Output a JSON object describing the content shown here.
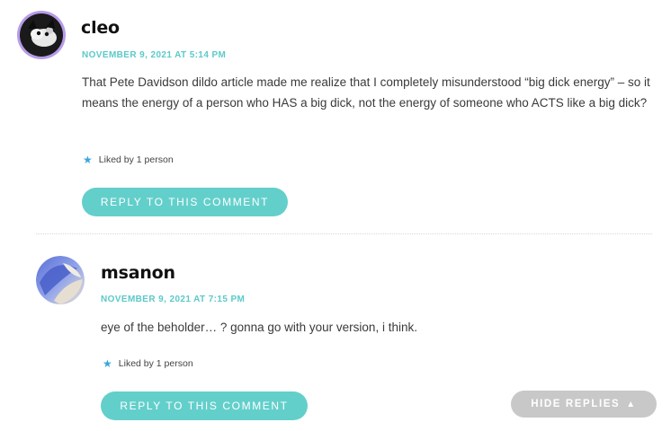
{
  "comments": [
    {
      "author": "cleo",
      "date": "NOVEMBER 9, 2021 AT 5:14 PM",
      "text": "That Pete Davidson dildo article made me realize that I completely misunderstood “big dick energy” – so it means the energy of a person who HAS a big dick, not the energy of someone who ACTS like a big dick?",
      "likes": "Liked by 1 person",
      "reply_label": "REPLY TO THIS COMMENT",
      "avatar_icon": "cat-photo-avatar"
    },
    {
      "author": "msanon",
      "date": "NOVEMBER 9, 2021 AT 7:15 PM",
      "text": "eye of the beholder… ? gonna go with your version, i think.",
      "likes": "Liked by 1 person",
      "reply_label": "REPLY TO THIS COMMENT",
      "avatar_icon": "abstract-blue-avatar"
    }
  ],
  "hide_replies_label": "HIDE REPLIES",
  "hide_replies_icon": "triangle-up-icon",
  "like_icon": "star-icon",
  "colors": {
    "accent": "#63cfcb",
    "date": "#5cc9c9",
    "hide_button": "#c8c8c8",
    "avatar_ring": "#b79be8"
  }
}
